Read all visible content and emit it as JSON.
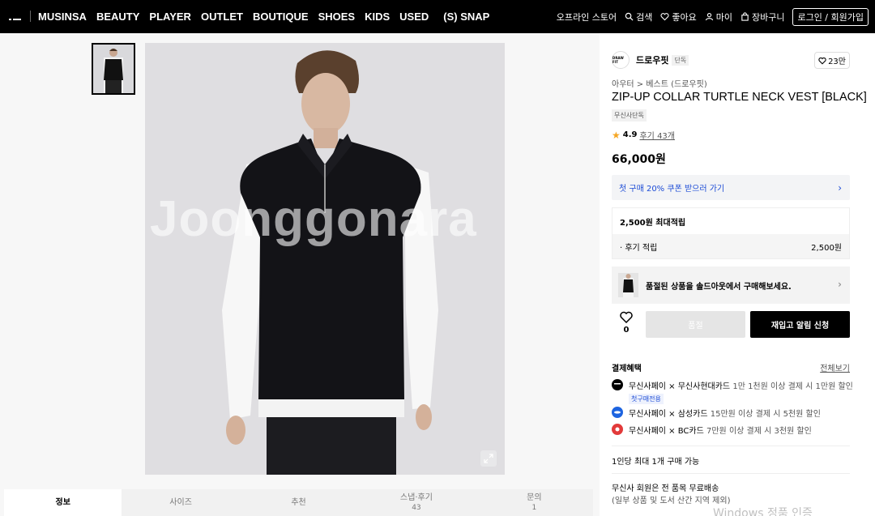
{
  "nav": {
    "items": [
      "MUSINSA",
      "BEAUTY",
      "PLAYER",
      "OUTLET",
      "BOUTIQUE",
      "SHOES",
      "KIDS",
      "USED",
      "(S) SNAP"
    ],
    "offline_store": "오프라인 스토어",
    "search": "검색",
    "likes": "좋아요",
    "my": "마이",
    "cart": "장바구니",
    "login": "로그인 / 회원가입"
  },
  "gallery": {
    "watermark": "Joonggonara"
  },
  "tabs": [
    {
      "label": "정보",
      "count": ""
    },
    {
      "label": "사이즈",
      "count": ""
    },
    {
      "label": "추천",
      "count": ""
    },
    {
      "label": "스냅·후기",
      "count": "43"
    },
    {
      "label": "문의",
      "count": "1"
    }
  ],
  "product": {
    "brand_logo_text": "DRAW FIT",
    "brand": "드로우핏",
    "brand_badge": "단독",
    "like_count": "23만",
    "breadcrumb": "아우터 > 베스트 (드로우핏)",
    "name": "ZIP-UP COLLAR TURTLE NECK VEST [BLACK]",
    "exclusive_badge": "무신사단독",
    "rating": "4.9",
    "review_text": "후기 43개",
    "price": "66,000원",
    "coupon_text": "첫 구매 20% 쿠폰 받으러 가기",
    "points_head": "2,500원 최대적립",
    "points_row_label": "· 후기 적립",
    "points_row_value": "2,500원",
    "soldout_banner": "품절된 상품을 솔드아웃에서 구매해보세요.",
    "wish_count": "0",
    "soldout_button": "품절",
    "restock_button": "재입고 알림 신청"
  },
  "benefits": {
    "title": "결제혜택",
    "view_all": "전체보기",
    "items": [
      {
        "name": "무신사페이 × 무신사현대카드",
        "desc": "1만 1천원 이상 결제 시 1만원 할인",
        "tag": "첫구매전용",
        "color": "#000000"
      },
      {
        "name": "무신사페이 × 삼성카드",
        "desc": "15만원 이상 결제 시 5천원 할인",
        "tag": "",
        "color": "#1d64e0"
      },
      {
        "name": "무신사페이 × BC카드",
        "desc": "7만원 이상 결제 시 3천원 할인",
        "tag": "",
        "color": "#e23a3a"
      }
    ]
  },
  "purchase_limit": "1인당 최대 1개 구매 가능",
  "shipping": {
    "line1": "무신사 회원은 전 품목 무료배송",
    "line2": "(일부 상품 및 도서 산간 지역 제외)"
  },
  "os_watermark": "Windows 정품 인증"
}
